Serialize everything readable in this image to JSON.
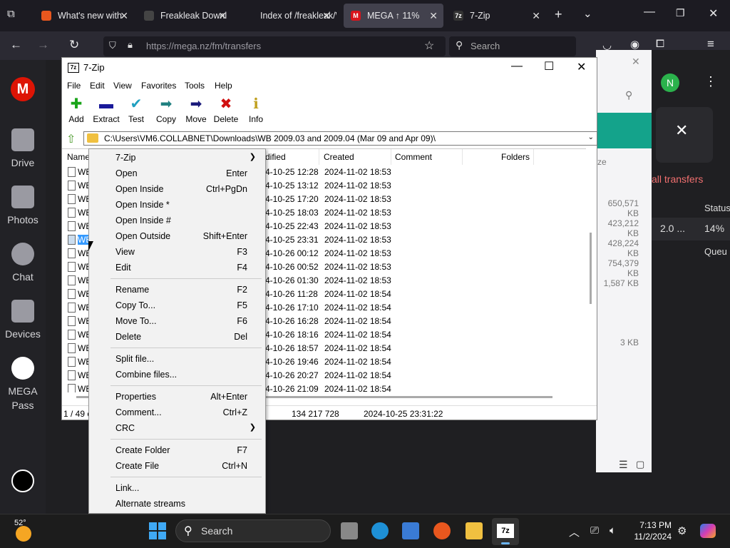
{
  "browser": {
    "tabs": [
      {
        "label": "What's new with",
        "favicon": "firefox-icon",
        "active": false
      },
      {
        "label": "Freakleak Downl",
        "favicon": "site-icon",
        "active": false
      },
      {
        "label": "Index of /freakleak/W",
        "favicon": "none",
        "active": false
      },
      {
        "label": "MEGA ↑ 11%",
        "favicon": "mega-icon",
        "active": true
      },
      {
        "label": "7-Zip",
        "favicon": "7zip-icon",
        "active": false
      }
    ],
    "url": "https://mega.nz/fm/transfers",
    "search_placeholder": "Search"
  },
  "mega": {
    "logo": "M",
    "sidebar": [
      {
        "label": "Drive",
        "icon": "folder-icon"
      },
      {
        "label": "Photos",
        "icon": "photos-icon"
      },
      {
        "label": "Chat",
        "icon": "chat-icon"
      },
      {
        "label": "Devices",
        "icon": "devices-icon"
      },
      {
        "label": "MEGA Pass",
        "icon": "lock-icon"
      }
    ],
    "avatar": "N",
    "all_transfers": "all transfers",
    "size_header": "ze",
    "status_header": "Status",
    "sizes": [
      "650,571 KB",
      "423,212 KB",
      "428,224 KB",
      "754,379 KB",
      "1,587 KB",
      "3 KB"
    ],
    "transfer_row": {
      "speed": "2.0 ...",
      "percent": "14%"
    },
    "queued": "Queu"
  },
  "sevenzip": {
    "title": "7-Zip",
    "menus": [
      "File",
      "Edit",
      "View",
      "Favorites",
      "Tools",
      "Help"
    ],
    "toolbar": [
      {
        "label": "Add",
        "icon": "add-icon",
        "color": "#1aa51a"
      },
      {
        "label": "Extract",
        "icon": "extract-icon",
        "color": "#1a1a9a"
      },
      {
        "label": "Test",
        "icon": "test-icon",
        "color": "#20a0c0"
      },
      {
        "label": "Copy",
        "icon": "copy-icon",
        "color": "#208080"
      },
      {
        "label": "Move",
        "icon": "move-icon",
        "color": "#1a1a7a"
      },
      {
        "label": "Delete",
        "icon": "delete-icon",
        "color": "#d01010"
      },
      {
        "label": "Info",
        "icon": "info-icon",
        "color": "#c0a020"
      }
    ],
    "path": "C:\\Users\\VM6.COLLABNET\\Downloads\\WB 2009.03 and 2009.04 (Mar 09 and Apr 09)\\",
    "columns": {
      "name": "Name",
      "modified": "dified",
      "created": "Created",
      "comment": "Comment",
      "folders": "Folders"
    },
    "rows": [
      {
        "name": "WE",
        "modified": "4-10-25 12:28",
        "created": "2024-11-02 18:53"
      },
      {
        "name": "WE",
        "modified": "4-10-25 13:12",
        "created": "2024-11-02 18:53"
      },
      {
        "name": "WE",
        "modified": "4-10-25 17:20",
        "created": "2024-11-02 18:53"
      },
      {
        "name": "WE",
        "modified": "4-10-25 18:03",
        "created": "2024-11-02 18:53"
      },
      {
        "name": "WE",
        "modified": "4-10-25 22:43",
        "created": "2024-11-02 18:53"
      },
      {
        "name": "WE",
        "modified": "4-10-25 23:31",
        "created": "2024-11-02 18:53",
        "selected": true
      },
      {
        "name": "WE",
        "modified": "4-10-26 00:12",
        "created": "2024-11-02 18:53"
      },
      {
        "name": "WE",
        "modified": "4-10-26 00:52",
        "created": "2024-11-02 18:53"
      },
      {
        "name": "WE",
        "modified": "4-10-26 01:30",
        "created": "2024-11-02 18:53"
      },
      {
        "name": "WE",
        "modified": "4-10-26 11:28",
        "created": "2024-11-02 18:54"
      },
      {
        "name": "WE",
        "modified": "4-10-26 17:10",
        "created": "2024-11-02 18:54"
      },
      {
        "name": "WE",
        "modified": "4-10-26 16:28",
        "created": "2024-11-02 18:54"
      },
      {
        "name": "WE",
        "modified": "4-10-26 18:16",
        "created": "2024-11-02 18:54"
      },
      {
        "name": "WE",
        "modified": "4-10-26 18:57",
        "created": "2024-11-02 18:54"
      },
      {
        "name": "WE",
        "modified": "4-10-26 19:46",
        "created": "2024-11-02 18:54"
      },
      {
        "name": "WE",
        "modified": "4-10-26 20:27",
        "created": "2024-11-02 18:54"
      },
      {
        "name": "WE",
        "modified": "4-10-26 21:09",
        "created": "2024-11-02 18:54"
      }
    ],
    "status": {
      "count": "1 / 49 o",
      "size": "134 217 728",
      "date": "2024-10-25 23:31:22"
    }
  },
  "context_menu": [
    {
      "label": "7-Zip",
      "key": "",
      "submenu": true
    },
    {
      "label": "Open",
      "key": "Enter"
    },
    {
      "label": "Open Inside",
      "key": "Ctrl+PgDn"
    },
    {
      "label": "Open Inside *",
      "key": ""
    },
    {
      "label": "Open Inside #",
      "key": ""
    },
    {
      "label": "Open Outside",
      "key": "Shift+Enter"
    },
    {
      "label": "View",
      "key": "F3"
    },
    {
      "label": "Edit",
      "key": "F4"
    },
    {
      "sep": true
    },
    {
      "label": "Rename",
      "key": "F2"
    },
    {
      "label": "Copy To...",
      "key": "F5"
    },
    {
      "label": "Move To...",
      "key": "F6"
    },
    {
      "label": "Delete",
      "key": "Del"
    },
    {
      "sep": true
    },
    {
      "label": "Split file...",
      "key": ""
    },
    {
      "label": "Combine files...",
      "key": ""
    },
    {
      "sep": true
    },
    {
      "label": "Properties",
      "key": "Alt+Enter"
    },
    {
      "label": "Comment...",
      "key": "Ctrl+Z"
    },
    {
      "label": "CRC",
      "key": "",
      "submenu": true
    },
    {
      "sep": true
    },
    {
      "label": "Create Folder",
      "key": "F7"
    },
    {
      "label": "Create File",
      "key": "Ctrl+N"
    },
    {
      "sep": true
    },
    {
      "label": "Link...",
      "key": ""
    },
    {
      "label": "Alternate streams",
      "key": ""
    }
  ],
  "taskbar": {
    "temperature": "52°",
    "search": "Search",
    "time": "7:13 PM",
    "date": "11/2/2024"
  }
}
